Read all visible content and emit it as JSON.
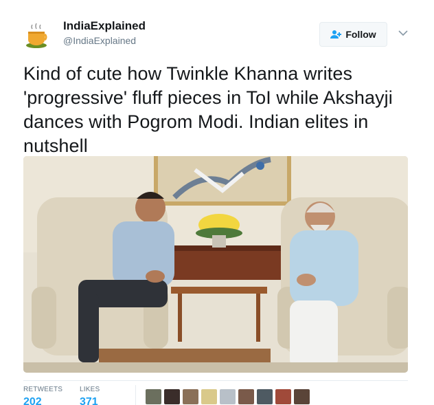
{
  "user": {
    "name": "IndiaExplained",
    "handle": "@IndiaExplained",
    "avatar_icon": "tea-cup-icon"
  },
  "follow_button": {
    "label": "Follow",
    "icon": "add-user-icon"
  },
  "menu_icon": "chevron-down-icon",
  "tweet": {
    "text_lines": [
      "Kind of cute how Twinkle Khanna writes",
      "'progressive' fluff pieces in ToI while Akshayji",
      "dances with Pogrom Modi. Indian elites in",
      "nutshell"
    ]
  },
  "stats": {
    "retweets_label": "RETWEETS",
    "retweets_count": "202",
    "likes_label": "LIKES",
    "likes_count": "371"
  },
  "likers": [
    {
      "color": "#6b6f5e"
    },
    {
      "color": "#3a2d2a"
    },
    {
      "color": "#8a7058"
    },
    {
      "color": "#d9c98a"
    },
    {
      "color": "#b8c0c8"
    },
    {
      "color": "#7a5a4a"
    },
    {
      "color": "#4e5a62"
    },
    {
      "color": "#a04a3a"
    },
    {
      "color": "#5a4438"
    }
  ],
  "colors": {
    "accent": "#1da1f2",
    "text_primary": "#14171a",
    "text_secondary": "#657786"
  }
}
